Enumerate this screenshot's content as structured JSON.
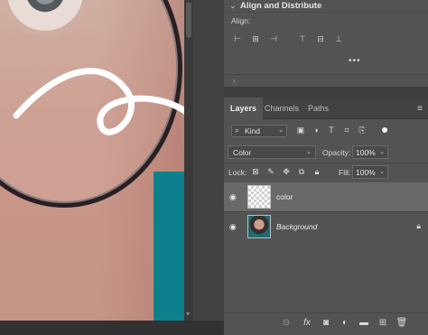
{
  "align_panel": {
    "title": "Align and Distribute",
    "align_label": "Align:",
    "more": "•••"
  },
  "layers_panel": {
    "tabs": [
      {
        "label": "Layers",
        "active": true
      },
      {
        "label": "Channels",
        "active": false
      },
      {
        "label": "Paths",
        "active": false
      }
    ],
    "filter": {
      "kind_label": "Kind"
    },
    "blend_mode": "Color",
    "opacity_label": "Opacity:",
    "opacity_value": "100%",
    "lock_label": "Lock:",
    "fill_label": "Fill:",
    "fill_value": "100%",
    "layers": [
      {
        "name": "color",
        "selected": true,
        "visible": true,
        "thumbnail": "transparent"
      },
      {
        "name": "Background",
        "selected": false,
        "visible": true,
        "thumbnail": "photo",
        "locked": true
      }
    ]
  },
  "icons": {
    "collapse": "chevron-down-icon",
    "panel_menu": "menu-icon",
    "eye": "eye-icon",
    "lock": "lock-icon",
    "link": "link-icon",
    "fx": "fx-icon",
    "mask": "mask-icon",
    "adjustment": "adjustment-icon",
    "folder": "folder-icon",
    "new_layer": "new-layer-icon",
    "delete": "trash-icon"
  },
  "colors": {
    "panel_bg": "#535353",
    "selected_row": "#696969",
    "teal_background": "#0e7f8c"
  }
}
